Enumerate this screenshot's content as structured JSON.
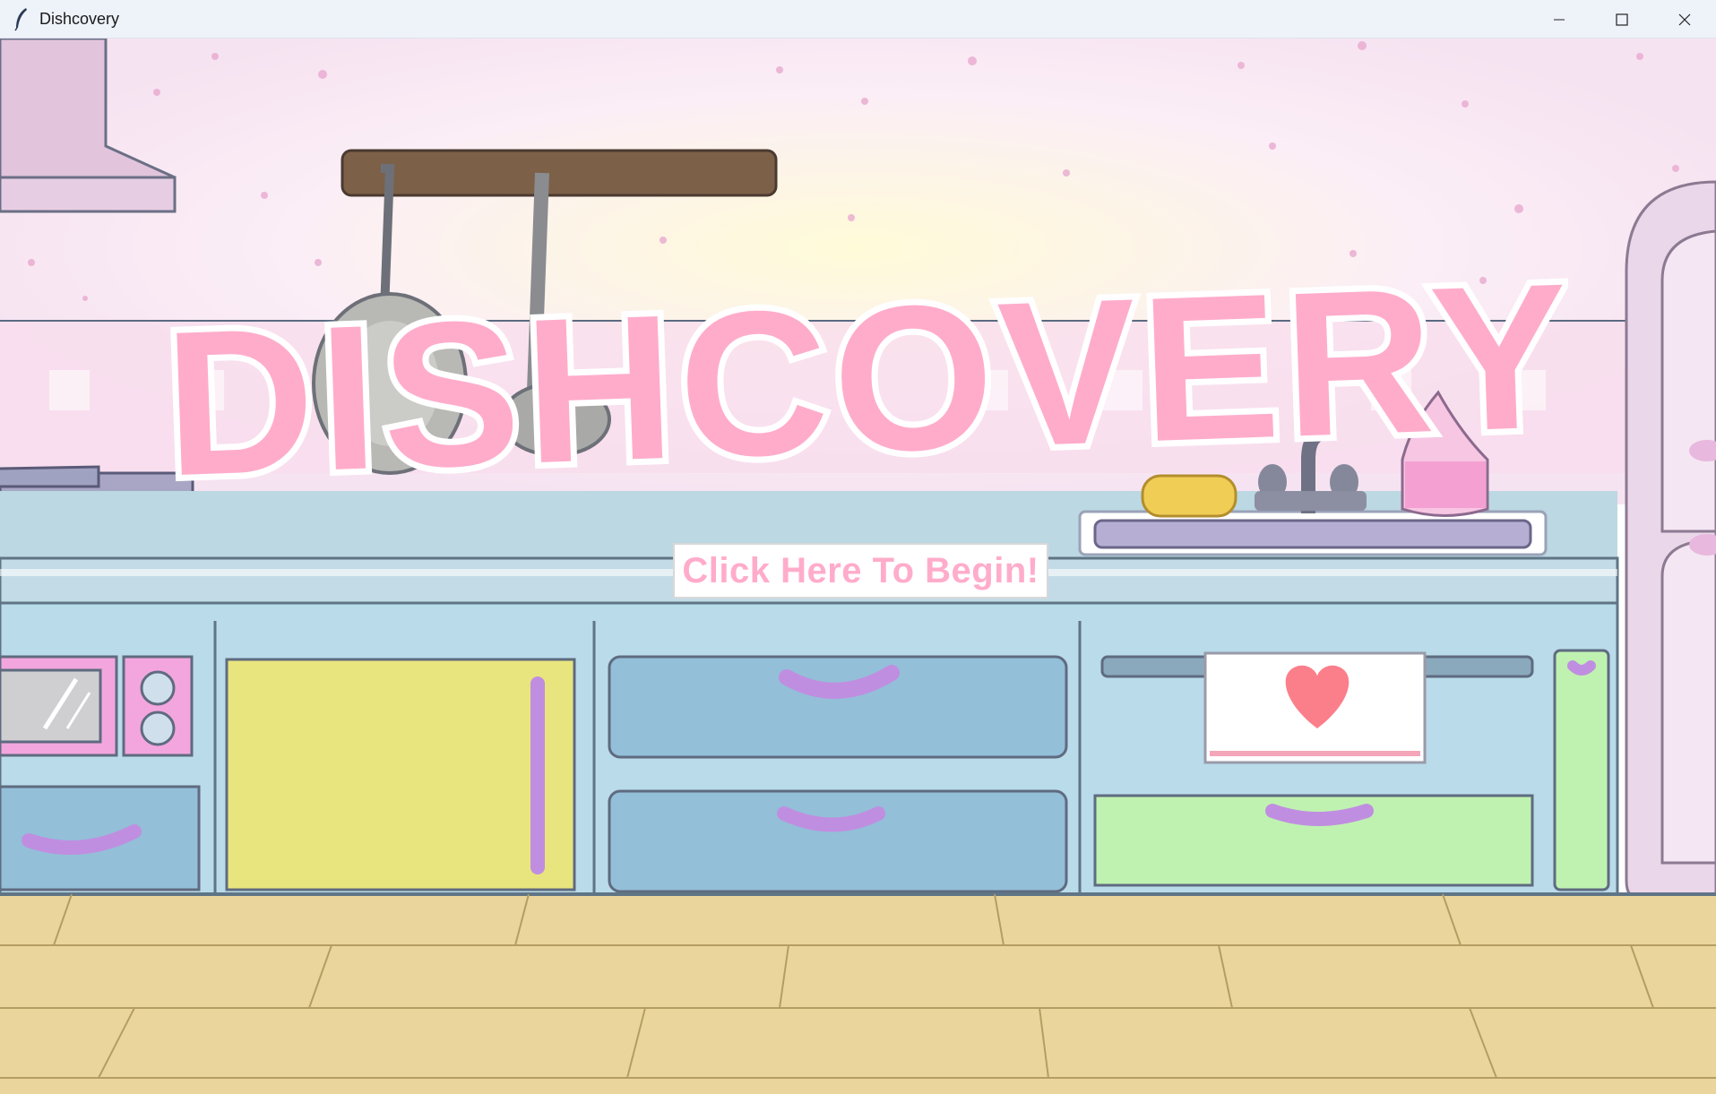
{
  "window": {
    "title": "Dishcovery",
    "controls": [
      "minimize-icon",
      "maximize-icon",
      "close-icon"
    ]
  },
  "game": {
    "logo_text": "DISHCOVERY",
    "start_button_label": "Click Here To Begin!"
  },
  "colors": {
    "logo_pink": "#ffaccb",
    "button_text": "#ffaccb",
    "wall": "#f7e8f4",
    "counter": "#bfe0ee",
    "floor": "#ead69c",
    "drawer_blue": "#93bfd8",
    "cabinet_yellow": "#e8e57e",
    "drawer_green": "#bff2b1",
    "handle_purple": "#c08ee0"
  }
}
